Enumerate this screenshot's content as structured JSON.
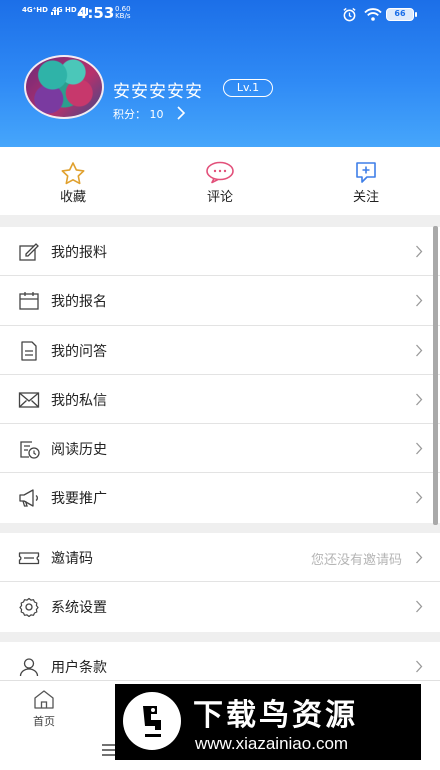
{
  "status_bar": {
    "net1": "4G⁺HD",
    "net2": "4G HD",
    "time": "4:53",
    "speed_value": "0.60",
    "speed_unit": "KB/s",
    "battery": "66"
  },
  "profile": {
    "username": "安安安安安",
    "level": "Lv.1",
    "points_label": "积分：",
    "points_value": "10"
  },
  "quick_actions": [
    {
      "label": "收藏",
      "icon": "star-icon",
      "color": "#e0a12f"
    },
    {
      "label": "评论",
      "icon": "comment-icon",
      "color": "#e2507a"
    },
    {
      "label": "关注",
      "icon": "follow-icon",
      "color": "#3f7fe8"
    }
  ],
  "menu_group_1": [
    {
      "label": "我的报料",
      "icon": "edit-box-icon"
    },
    {
      "label": "我的报名",
      "icon": "calendar-icon"
    },
    {
      "label": "我的问答",
      "icon": "document-icon"
    },
    {
      "label": "我的私信",
      "icon": "mail-icon"
    },
    {
      "label": "阅读历史",
      "icon": "history-icon"
    },
    {
      "label": "我要推广",
      "icon": "megaphone-icon"
    }
  ],
  "menu_group_2": [
    {
      "label": "邀请码",
      "icon": "ticket-icon",
      "hint": "您还没有邀请码"
    },
    {
      "label": "系统设置",
      "icon": "settings-icon"
    }
  ],
  "menu_group_3": [
    {
      "label": "用户条款",
      "icon": "user-icon"
    }
  ],
  "bottom_nav": {
    "home_label": "首页"
  },
  "watermark": {
    "brand": "下载鸟资源",
    "url": "www.xiazainiao.com"
  },
  "colors": {
    "header_top": "#1c6fe8",
    "header_bottom": "#46a6fb",
    "background": "#efefef"
  }
}
